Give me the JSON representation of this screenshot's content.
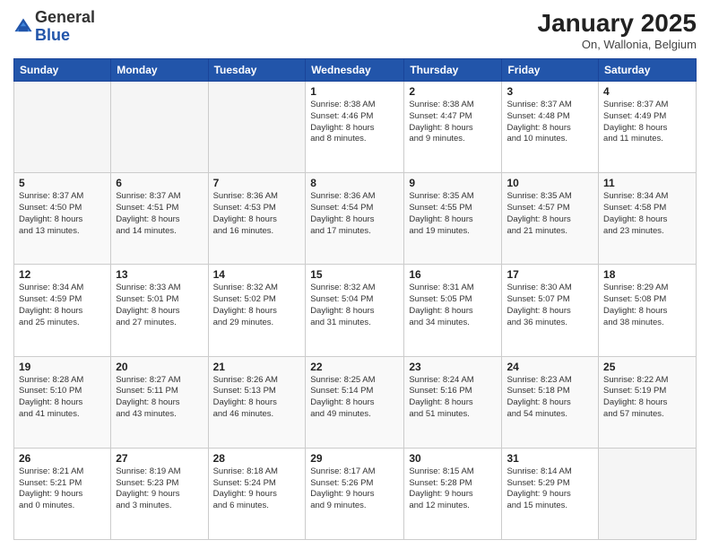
{
  "header": {
    "logo_general": "General",
    "logo_blue": "Blue",
    "month_title": "January 2025",
    "location": "On, Wallonia, Belgium"
  },
  "weekdays": [
    "Sunday",
    "Monday",
    "Tuesday",
    "Wednesday",
    "Thursday",
    "Friday",
    "Saturday"
  ],
  "weeks": [
    [
      {
        "day": "",
        "info": ""
      },
      {
        "day": "",
        "info": ""
      },
      {
        "day": "",
        "info": ""
      },
      {
        "day": "1",
        "info": "Sunrise: 8:38 AM\nSunset: 4:46 PM\nDaylight: 8 hours\nand 8 minutes."
      },
      {
        "day": "2",
        "info": "Sunrise: 8:38 AM\nSunset: 4:47 PM\nDaylight: 8 hours\nand 9 minutes."
      },
      {
        "day": "3",
        "info": "Sunrise: 8:37 AM\nSunset: 4:48 PM\nDaylight: 8 hours\nand 10 minutes."
      },
      {
        "day": "4",
        "info": "Sunrise: 8:37 AM\nSunset: 4:49 PM\nDaylight: 8 hours\nand 11 minutes."
      }
    ],
    [
      {
        "day": "5",
        "info": "Sunrise: 8:37 AM\nSunset: 4:50 PM\nDaylight: 8 hours\nand 13 minutes."
      },
      {
        "day": "6",
        "info": "Sunrise: 8:37 AM\nSunset: 4:51 PM\nDaylight: 8 hours\nand 14 minutes."
      },
      {
        "day": "7",
        "info": "Sunrise: 8:36 AM\nSunset: 4:53 PM\nDaylight: 8 hours\nand 16 minutes."
      },
      {
        "day": "8",
        "info": "Sunrise: 8:36 AM\nSunset: 4:54 PM\nDaylight: 8 hours\nand 17 minutes."
      },
      {
        "day": "9",
        "info": "Sunrise: 8:35 AM\nSunset: 4:55 PM\nDaylight: 8 hours\nand 19 minutes."
      },
      {
        "day": "10",
        "info": "Sunrise: 8:35 AM\nSunset: 4:57 PM\nDaylight: 8 hours\nand 21 minutes."
      },
      {
        "day": "11",
        "info": "Sunrise: 8:34 AM\nSunset: 4:58 PM\nDaylight: 8 hours\nand 23 minutes."
      }
    ],
    [
      {
        "day": "12",
        "info": "Sunrise: 8:34 AM\nSunset: 4:59 PM\nDaylight: 8 hours\nand 25 minutes."
      },
      {
        "day": "13",
        "info": "Sunrise: 8:33 AM\nSunset: 5:01 PM\nDaylight: 8 hours\nand 27 minutes."
      },
      {
        "day": "14",
        "info": "Sunrise: 8:32 AM\nSunset: 5:02 PM\nDaylight: 8 hours\nand 29 minutes."
      },
      {
        "day": "15",
        "info": "Sunrise: 8:32 AM\nSunset: 5:04 PM\nDaylight: 8 hours\nand 31 minutes."
      },
      {
        "day": "16",
        "info": "Sunrise: 8:31 AM\nSunset: 5:05 PM\nDaylight: 8 hours\nand 34 minutes."
      },
      {
        "day": "17",
        "info": "Sunrise: 8:30 AM\nSunset: 5:07 PM\nDaylight: 8 hours\nand 36 minutes."
      },
      {
        "day": "18",
        "info": "Sunrise: 8:29 AM\nSunset: 5:08 PM\nDaylight: 8 hours\nand 38 minutes."
      }
    ],
    [
      {
        "day": "19",
        "info": "Sunrise: 8:28 AM\nSunset: 5:10 PM\nDaylight: 8 hours\nand 41 minutes."
      },
      {
        "day": "20",
        "info": "Sunrise: 8:27 AM\nSunset: 5:11 PM\nDaylight: 8 hours\nand 43 minutes."
      },
      {
        "day": "21",
        "info": "Sunrise: 8:26 AM\nSunset: 5:13 PM\nDaylight: 8 hours\nand 46 minutes."
      },
      {
        "day": "22",
        "info": "Sunrise: 8:25 AM\nSunset: 5:14 PM\nDaylight: 8 hours\nand 49 minutes."
      },
      {
        "day": "23",
        "info": "Sunrise: 8:24 AM\nSunset: 5:16 PM\nDaylight: 8 hours\nand 51 minutes."
      },
      {
        "day": "24",
        "info": "Sunrise: 8:23 AM\nSunset: 5:18 PM\nDaylight: 8 hours\nand 54 minutes."
      },
      {
        "day": "25",
        "info": "Sunrise: 8:22 AM\nSunset: 5:19 PM\nDaylight: 8 hours\nand 57 minutes."
      }
    ],
    [
      {
        "day": "26",
        "info": "Sunrise: 8:21 AM\nSunset: 5:21 PM\nDaylight: 9 hours\nand 0 minutes."
      },
      {
        "day": "27",
        "info": "Sunrise: 8:19 AM\nSunset: 5:23 PM\nDaylight: 9 hours\nand 3 minutes."
      },
      {
        "day": "28",
        "info": "Sunrise: 8:18 AM\nSunset: 5:24 PM\nDaylight: 9 hours\nand 6 minutes."
      },
      {
        "day": "29",
        "info": "Sunrise: 8:17 AM\nSunset: 5:26 PM\nDaylight: 9 hours\nand 9 minutes."
      },
      {
        "day": "30",
        "info": "Sunrise: 8:15 AM\nSunset: 5:28 PM\nDaylight: 9 hours\nand 12 minutes."
      },
      {
        "day": "31",
        "info": "Sunrise: 8:14 AM\nSunset: 5:29 PM\nDaylight: 9 hours\nand 15 minutes."
      },
      {
        "day": "",
        "info": ""
      }
    ]
  ]
}
